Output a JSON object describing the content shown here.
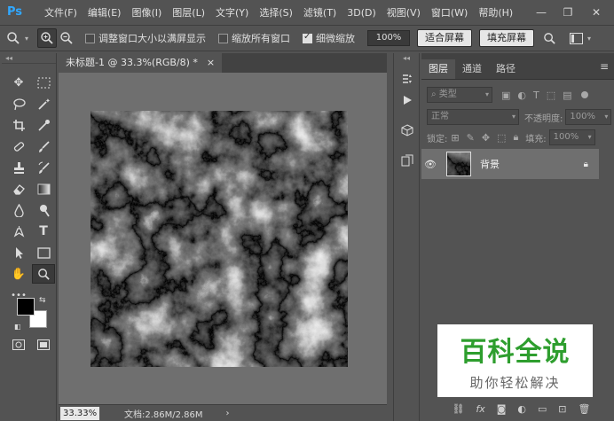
{
  "app": {
    "logo": "Ps"
  },
  "menu": [
    "文件(F)",
    "编辑(E)",
    "图像(I)",
    "图层(L)",
    "文字(Y)",
    "选择(S)",
    "滤镜(T)",
    "3D(D)",
    "视图(V)",
    "窗口(W)",
    "帮助(H)"
  ],
  "window_controls": {
    "minimize": "—",
    "restore": "❐",
    "close": "✕"
  },
  "options": {
    "resize_windows_label": "调整窗口大小以满屏显示",
    "resize_windows_checked": false,
    "zoom_all_label": "缩放所有窗口",
    "zoom_all_checked": false,
    "scrubby_zoom_label": "细微缩放",
    "scrubby_zoom_checked": true,
    "zoom_value": "100%",
    "fit_screen_label": "适合屏幕",
    "fill_screen_label": "填充屏幕"
  },
  "document": {
    "tab_title": "未标题-1 @ 33.3%(RGB/8) *",
    "tab_close": "×"
  },
  "status": {
    "zoom": "33.33%",
    "doc_info": "文档:2.86M/2.86M",
    "arrow": "›"
  },
  "layers_panel": {
    "tabs": [
      "图层",
      "通道",
      "路径"
    ],
    "kind_filter": "类型",
    "blend_mode": "正常",
    "opacity_label": "不透明度:",
    "opacity_value": "100%",
    "lock_label": "锁定:",
    "fill_label": "填充:",
    "fill_value": "100%",
    "layer_name": "背景"
  },
  "watermark": {
    "title": "百科全说",
    "subtitle": "助你轻松解决"
  },
  "colors": {
    "ui_bg": "#535353",
    "canvas_bg": "#6f6f6f",
    "ps_blue": "#31a8ff",
    "watermark_green": "#2e9e2e"
  }
}
